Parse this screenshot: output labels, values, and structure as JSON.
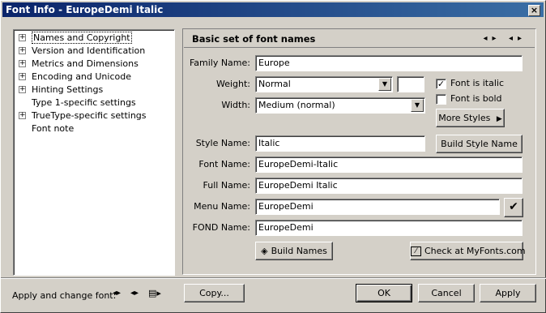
{
  "window": {
    "title": "Font Info - EuropeDemi Italic",
    "close_glyph": "×"
  },
  "tree": [
    {
      "label": "Names and Copyright",
      "expandable": true,
      "selected": true
    },
    {
      "label": "Version and Identification",
      "expandable": true
    },
    {
      "label": "Metrics and Dimensions",
      "expandable": true
    },
    {
      "label": "Encoding and Unicode",
      "expandable": true
    },
    {
      "label": "Hinting Settings",
      "expandable": true
    },
    {
      "label": "Type 1-specific settings",
      "expandable": false
    },
    {
      "label": "TrueType-specific settings",
      "expandable": true
    },
    {
      "label": "Font note",
      "expandable": false
    }
  ],
  "panel": {
    "title": "Basic set of font names",
    "family_label": "Family Name:",
    "family_value": "Europe",
    "weight_label": "Weight:",
    "weight_value": "Normal",
    "weight_number": "",
    "width_label": "Width:",
    "width_value": "Medium (normal)",
    "italic_label": "Font is italic",
    "italic_checked": true,
    "bold_label": "Font is bold",
    "bold_checked": false,
    "more_styles": "More Styles",
    "style_label": "Style Name:",
    "style_value": "Italic",
    "build_style": "Build Style Name",
    "font_label": "Font Name:",
    "font_value": "EuropeDemi-Italic",
    "full_label": "Full Name:",
    "full_value": "EuropeDemi Italic",
    "menu_label": "Menu Name:",
    "menu_value": "EuropeDemi",
    "fond_label": "FOND Name:",
    "fond_value": "EuropeDemi",
    "build_names": "Build Names",
    "check_myfonts": "Check at MyFonts.com"
  },
  "footer": {
    "apply_change_label": "Apply and change font:",
    "copy": "Copy...",
    "ok": "OK",
    "cancel": "Cancel",
    "apply": "Apply"
  }
}
